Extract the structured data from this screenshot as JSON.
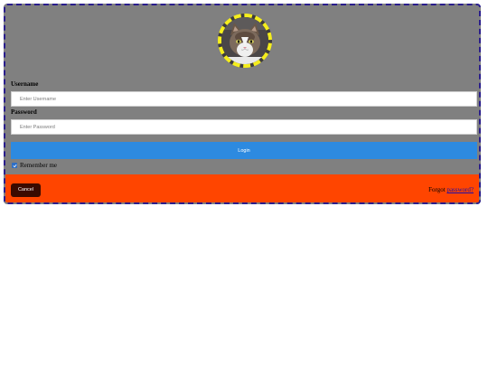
{
  "form": {
    "username_label": "Username",
    "username_placeholder": "Enter Username",
    "password_label": "Password",
    "password_placeholder": "Enter Password",
    "login_label": "Login",
    "remember_label": "Remember me",
    "remember_checked": true
  },
  "footer": {
    "cancel_label": "Cancel",
    "forgot_prefix": "Forgot ",
    "forgot_link": "password?"
  },
  "colors": {
    "card_bg": "#808080",
    "card_border": "#2a1e8c",
    "avatar_border": "#f5ee1c",
    "login_button": "#2d8ae0",
    "footer_bg": "#ff4500",
    "cancel_button": "#3a0a00",
    "link": "#1a0dab"
  },
  "icons": {
    "avatar": "cat-avatar-image",
    "checkbox": "checkmark-icon"
  }
}
